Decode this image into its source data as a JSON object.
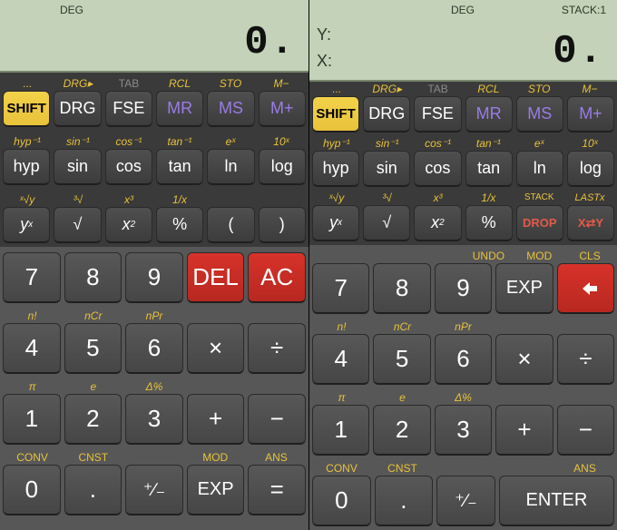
{
  "left": {
    "status": {
      "deg": "DEG"
    },
    "display": "0.",
    "topHints": [
      "...",
      "DRG▸",
      "TAB",
      "RCL",
      "STO",
      "M−"
    ],
    "topBtns": [
      "SHIFT",
      "DRG",
      "FSE",
      "MR",
      "MS",
      "M+"
    ],
    "trigHints": [
      "hyp⁻¹",
      "sin⁻¹",
      "cos⁻¹",
      "tan⁻¹",
      "eˣ",
      "10ˣ"
    ],
    "trigBtns": [
      "hyp",
      "sin",
      "cos",
      "tan",
      "ln",
      "log"
    ],
    "powHints": [
      "ˣ√y",
      "³√",
      "x³",
      "1/x",
      "",
      ""
    ],
    "powBtns": [
      "yx",
      "√",
      "x2",
      "%",
      "(",
      ")"
    ],
    "r1Hints": [
      "",
      "",
      "",
      "",
      ""
    ],
    "r1": [
      "7",
      "8",
      "9",
      "DEL",
      "AC"
    ],
    "r2Hints": [
      "n!",
      "nCr",
      "nPr",
      "",
      ""
    ],
    "r2": [
      "4",
      "5",
      "6",
      "×",
      "÷"
    ],
    "r3Hints": [
      "π",
      "e",
      "Δ%",
      "",
      ""
    ],
    "r3": [
      "1",
      "2",
      "3",
      "+",
      "−"
    ],
    "r4Hints": [
      "CONV",
      "CNST",
      "",
      "MOD",
      "ANS"
    ],
    "r4": [
      "0",
      ".",
      "⁺∕₋",
      "EXP",
      "="
    ]
  },
  "right": {
    "status": {
      "deg": "DEG",
      "stack": "STACK:1"
    },
    "labY": "Y:",
    "labX": "X:",
    "display": "0.",
    "topHints": [
      "...",
      "DRG▸",
      "TAB",
      "RCL",
      "STO",
      "M−"
    ],
    "topBtns": [
      "SHIFT",
      "DRG",
      "FSE",
      "MR",
      "MS",
      "M+"
    ],
    "trigHints": [
      "hyp⁻¹",
      "sin⁻¹",
      "cos⁻¹",
      "tan⁻¹",
      "eˣ",
      "10ˣ"
    ],
    "trigBtns": [
      "hyp",
      "sin",
      "cos",
      "tan",
      "ln",
      "log"
    ],
    "powHints": [
      "ˣ√y",
      "³√",
      "x³",
      "1/x",
      "STACK",
      "LASTx"
    ],
    "powBtns": [
      "yx",
      "√",
      "x2",
      "%",
      "DROP",
      "X⇄Y"
    ],
    "r1Hints": [
      "",
      "",
      "",
      "UNDO",
      "MOD",
      "CLS"
    ],
    "r1": [
      "7",
      "8",
      "9",
      "EXP",
      "←"
    ],
    "r2Hints": [
      "n!",
      "nCr",
      "nPr",
      "",
      ""
    ],
    "r2": [
      "4",
      "5",
      "6",
      "×",
      "÷"
    ],
    "r3Hints": [
      "π",
      "e",
      "Δ%",
      "",
      ""
    ],
    "r3": [
      "1",
      "2",
      "3",
      "+",
      "−"
    ],
    "r4Hints": [
      "CONV",
      "CNST",
      "",
      "",
      "ANS"
    ],
    "r4": [
      "0",
      ".",
      "⁺∕₋",
      "",
      "ENTER"
    ]
  }
}
